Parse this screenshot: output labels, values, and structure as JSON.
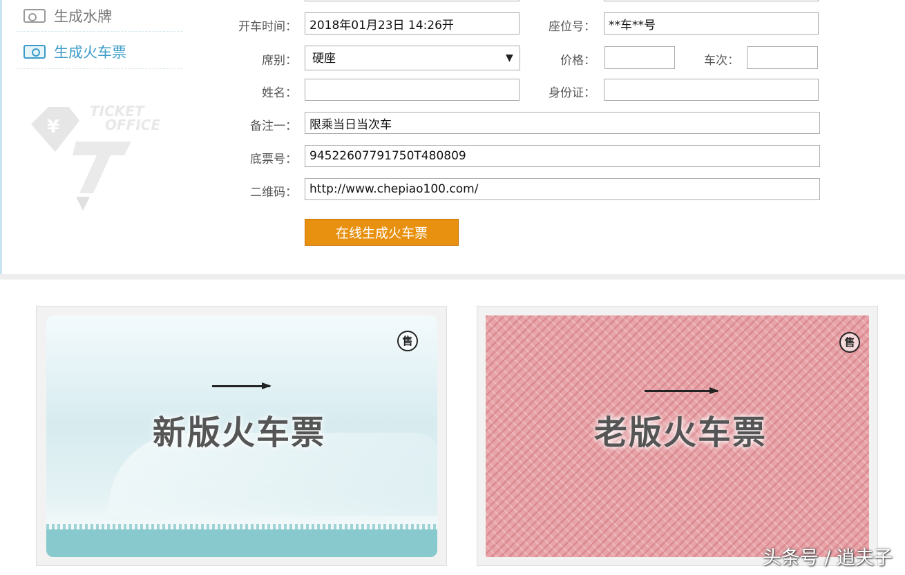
{
  "sidebar": {
    "items": [
      {
        "label": "生成水牌",
        "icon": "watermark-icon"
      },
      {
        "label": "生成火车票",
        "icon": "ticket-icon"
      }
    ],
    "logo": {
      "line1": "TICKET",
      "line2": "OFFICE",
      "symbol": "¥"
    }
  },
  "form": {
    "depart_time": {
      "label": "开车时间：",
      "value": "2018年01月23日 14:26开"
    },
    "seat_no": {
      "label": "座位号：",
      "value": "**车**号"
    },
    "seat_class": {
      "label": "席别：",
      "value": "硬座"
    },
    "price": {
      "label": "价格：",
      "value": ""
    },
    "train_no": {
      "label": "车次：",
      "value": ""
    },
    "name": {
      "label": "姓名：",
      "value": ""
    },
    "id_card": {
      "label": "身份证：",
      "value": ""
    },
    "note1": {
      "label": "备注一：",
      "value": "限乘当日当次车"
    },
    "ticket_base_no": {
      "label": "底票号：",
      "value": "94522607791750T480809"
    },
    "qr_code": {
      "label": "二维码：",
      "value": "http://www.chepiao100.com/"
    },
    "submit_label": "在线生成火车票"
  },
  "tickets": {
    "new": {
      "title": "新版火车票",
      "sell_mark": "售"
    },
    "old": {
      "title": "老版火车票",
      "sell_mark": "售"
    }
  },
  "watermark": "头条号 / 逍夫子",
  "colors": {
    "accent": "#e8900f",
    "link": "#3a9bc8",
    "new_ticket_band": "#87c9cd",
    "old_ticket_bg": "#e8a4a8"
  }
}
